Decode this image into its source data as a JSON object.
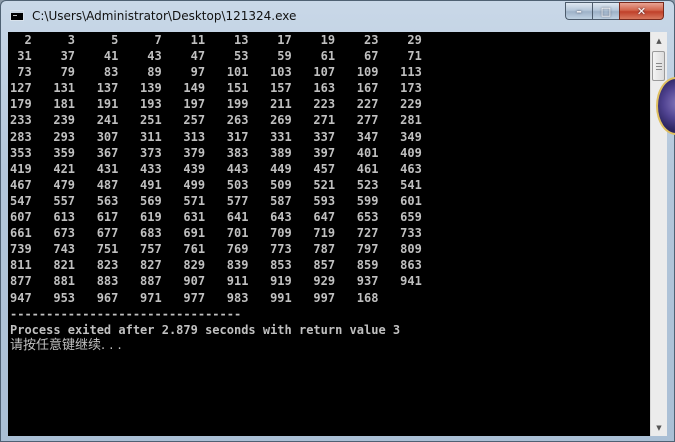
{
  "window": {
    "title": "C:\\Users\\Administrator\\Desktop\\121324.exe",
    "icon": "console-app-icon",
    "controls": {
      "minimize_glyph": "–",
      "maximize_glyph": "□",
      "close_glyph": "✕"
    }
  },
  "console": {
    "background": "#000000",
    "foreground": "#c0c0c0",
    "lines": [
      "  2     3     5     7    11    13    17    19    23    29",
      " 31    37    41    43    47    53    59    61    67    71",
      " 73    79    83    89    97   101   103   107   109   113",
      "127   131   137   139   149   151   157   163   167   173",
      "179   181   191   193   197   199   211   223   227   229",
      "233   239   241   251   257   263   269   271   277   281",
      "283   293   307   311   313   317   331   337   347   349",
      "353   359   367   373   379   383   389   397   401   409",
      "419   421   431   433   439   443   449   457   461   463",
      "467   479   487   491   499   503   509   521   523   541",
      "547   557   563   569   571   577   587   593   599   601",
      "607   613   617   619   631   641   643   647   653   659",
      "661   673   677   683   691   701   709   719   727   733",
      "739   743   751   757   761   769   773   787   797   809",
      "811   821   823   827   829   839   853   857   859   863",
      "877   881   883   887   907   911   919   929   937   941",
      "947   953   967   971   977   983   991   997   168",
      "--------------------------------",
      "Process exited after 2.879 seconds with return value 3",
      "请按任意键继续. . ."
    ]
  },
  "scrollbar": {
    "up_glyph": "▲",
    "down_glyph": "▼"
  }
}
